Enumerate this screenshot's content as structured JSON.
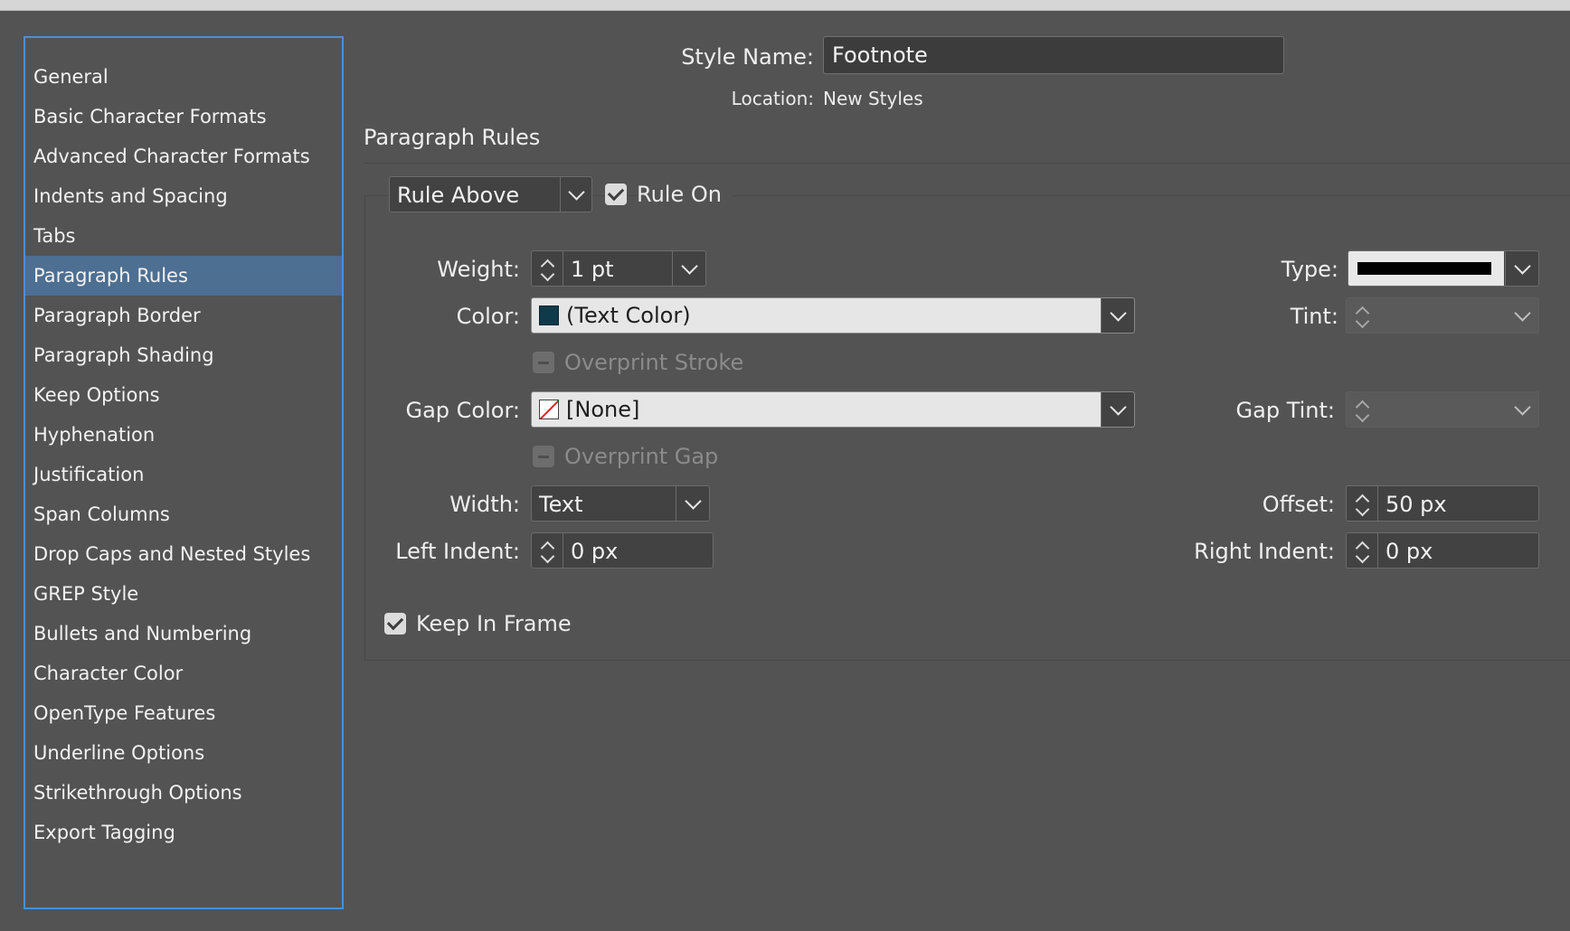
{
  "sidebar": {
    "items": [
      {
        "label": "General"
      },
      {
        "label": "Basic Character Formats"
      },
      {
        "label": "Advanced Character Formats"
      },
      {
        "label": "Indents and Spacing"
      },
      {
        "label": "Tabs"
      },
      {
        "label": "Paragraph Rules",
        "selected": true
      },
      {
        "label": "Paragraph Border"
      },
      {
        "label": "Paragraph Shading"
      },
      {
        "label": "Keep Options"
      },
      {
        "label": "Hyphenation"
      },
      {
        "label": "Justification"
      },
      {
        "label": "Span Columns"
      },
      {
        "label": "Drop Caps and Nested Styles"
      },
      {
        "label": "GREP Style"
      },
      {
        "label": "Bullets and Numbering"
      },
      {
        "label": "Character Color"
      },
      {
        "label": "OpenType Features"
      },
      {
        "label": "Underline Options"
      },
      {
        "label": "Strikethrough Options"
      },
      {
        "label": "Export Tagging"
      }
    ]
  },
  "header": {
    "style_name_label": "Style Name:",
    "style_name_value": "Footnote",
    "location_label": "Location:",
    "location_value": "New Styles"
  },
  "section": {
    "title": "Paragraph Rules",
    "rule_select": "Rule Above",
    "rule_on_label": "Rule On",
    "rule_on_checked": true
  },
  "fields": {
    "weight_label": "Weight:",
    "weight_value": "1 pt",
    "type_label": "Type:",
    "color_label": "Color:",
    "color_value": "(Text Color)",
    "tint_label": "Tint:",
    "tint_value": "",
    "overprint_stroke_label": "Overprint Stroke",
    "gap_color_label": "Gap Color:",
    "gap_color_value": "[None]",
    "gap_tint_label": "Gap Tint:",
    "gap_tint_value": "",
    "overprint_gap_label": "Overprint Gap",
    "width_label": "Width:",
    "width_value": "Text",
    "offset_label": "Offset:",
    "offset_value": "50 px",
    "left_indent_label": "Left Indent:",
    "left_indent_value": "0 px",
    "right_indent_label": "Right Indent:",
    "right_indent_value": "0 px",
    "keep_in_frame_label": "Keep In Frame",
    "keep_in_frame_checked": true
  },
  "colors": {
    "accent": "#4a8edb",
    "selection": "#4c6f92",
    "text_color_swatch": "#0f3a4a",
    "none_swatch_slash": "#e02020"
  },
  "icons": [
    "chevron-down-icon",
    "stepper-up-icon",
    "stepper-down-icon",
    "checkmark-icon",
    "none-swatch-icon",
    "color-swatch-icon"
  ]
}
